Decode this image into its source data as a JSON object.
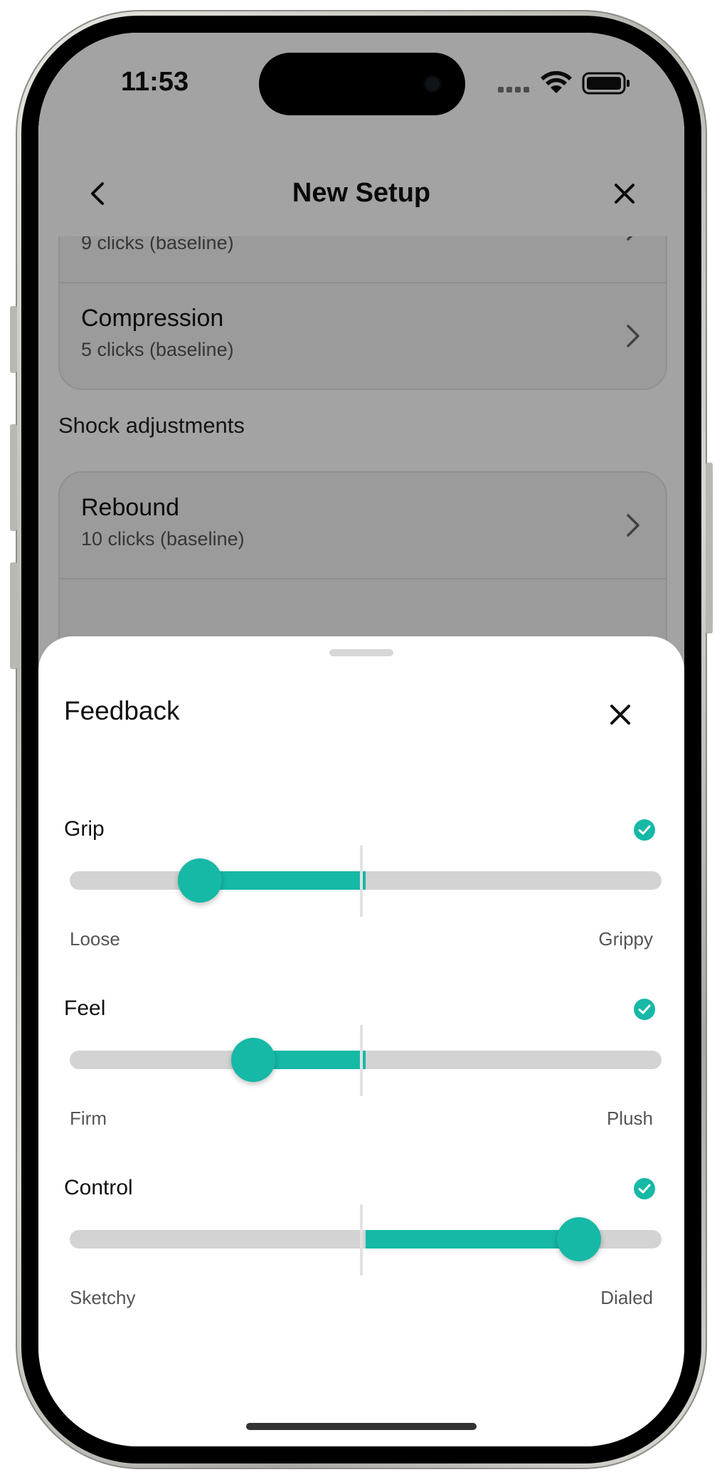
{
  "status_bar": {
    "time": "11:53"
  },
  "nav": {
    "title": "New Setup",
    "back_icon": "chevron-left-icon",
    "close_icon": "close-icon"
  },
  "fork_settings": [
    {
      "title": "",
      "subtitle": "9 clicks (baseline)"
    },
    {
      "title": "Compression",
      "subtitle": "5 clicks (baseline)"
    }
  ],
  "shock_section": {
    "title": "Shock adjustments",
    "rows": [
      {
        "title": "Rebound",
        "subtitle": "10 clicks (baseline)"
      }
    ]
  },
  "feedback_sheet": {
    "title": "Feedback",
    "close_icon": "close-icon",
    "sliders": [
      {
        "label": "Grip",
        "min_label": "Loose",
        "max_label": "Grippy",
        "value": 0.22,
        "checked": true
      },
      {
        "label": "Feel",
        "min_label": "Firm",
        "max_label": "Plush",
        "value": 0.31,
        "checked": true
      },
      {
        "label": "Control",
        "min_label": "Sketchy",
        "max_label": "Dialed",
        "value": 0.86,
        "checked": true
      }
    ]
  },
  "colors": {
    "accent": "#16b8a6",
    "track": "#d3d3d3",
    "scrim": "rgba(0,0,0,0.36)"
  }
}
